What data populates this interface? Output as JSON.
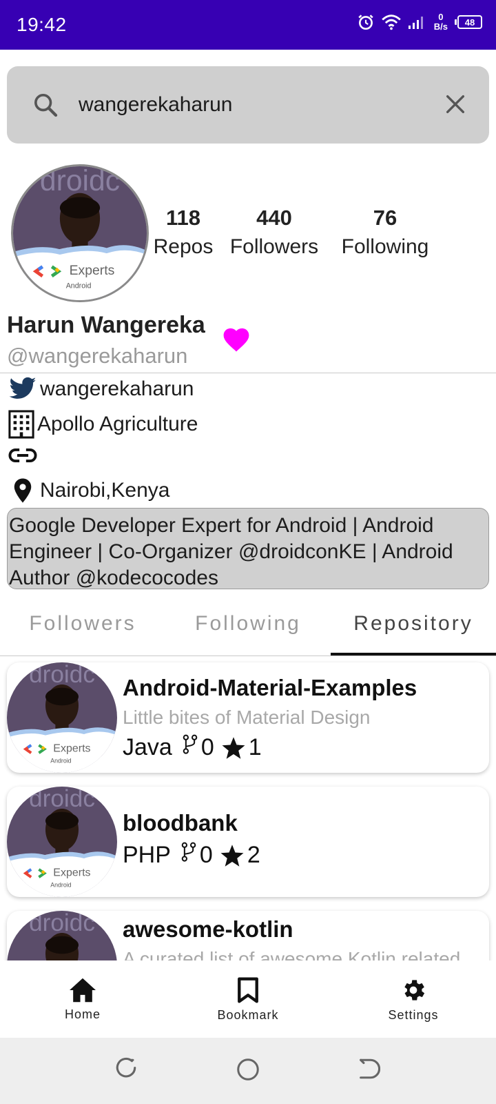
{
  "status_bar": {
    "time": "19:42",
    "net_speed_value": "0",
    "net_speed_unit": "B/s",
    "battery": "48",
    "color": "#3700b3"
  },
  "search": {
    "value": "wangerekaharun",
    "icon": "search-icon",
    "clear_icon": "close-icon"
  },
  "profile": {
    "avatar_badge": "Experts",
    "avatar_sub": "Android",
    "stats": [
      {
        "value": "118",
        "label": "Repos"
      },
      {
        "value": "440",
        "label": "Followers"
      },
      {
        "value": "76",
        "label": "Following"
      }
    ],
    "name": "Harun Wangereka",
    "handle": "@wangerekaharun",
    "favorite_color": "#ff00ff",
    "twitter": "wangerekaharun",
    "company": "Apollo Agriculture",
    "website": "",
    "location": "Nairobi,Kenya",
    "bio": "Google Developer Expert for Android | Android Engineer | Co-Organizer @droidconKE  | Android Author @kodecocodes"
  },
  "tabs": [
    {
      "label": "Followers",
      "active": false
    },
    {
      "label": "Following",
      "active": false
    },
    {
      "label": "Repository",
      "active": true
    }
  ],
  "repos": [
    {
      "name": "Android-Material-Examples",
      "description": "Little bites of Material Design",
      "language": "Java",
      "forks": "0",
      "stars": "1"
    },
    {
      "name": "bloodbank",
      "description": "",
      "language": "PHP",
      "forks": "0",
      "stars": "2"
    },
    {
      "name": "awesome-kotlin",
      "description": "A curated list of awesome Kotlin related",
      "language": "",
      "forks": "",
      "stars": ""
    }
  ],
  "bottom_nav": {
    "home": "Home",
    "bookmark": "Bookmark",
    "settings": "Settings"
  }
}
